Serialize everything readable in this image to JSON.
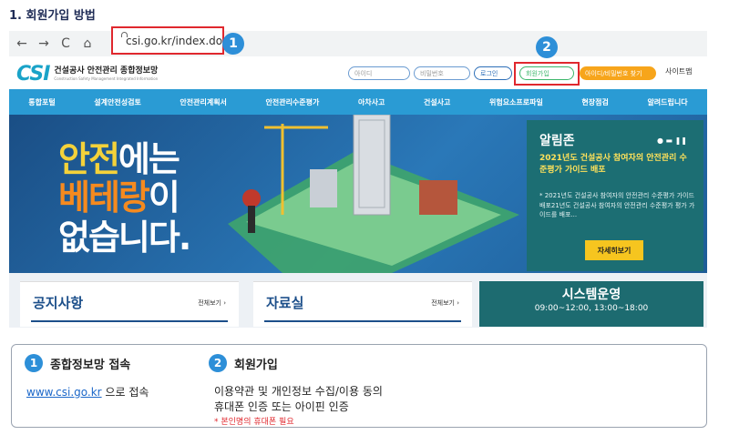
{
  "doc_title": "1. 회원가입 방법",
  "browser": {
    "back_glyph": "←",
    "forward_glyph": "→",
    "reload_glyph": "C",
    "home_glyph": "⌂",
    "url": "csi.go.kr/index.do",
    "badge1": "1",
    "badge2": "2"
  },
  "header": {
    "logo_mark_a": "CS",
    "logo_mark_b": "I",
    "logo_kr": "건설공사 안전관리 종합정보망",
    "logo_en": "Construction Safety Management Integrated Information",
    "id_placeholder": "아이디",
    "pw_placeholder": "비밀번호",
    "login_label": "로그인",
    "signup_label": "회원가입",
    "find_label": "아이디/비밀번호 찾기",
    "sitemap_label": "사이트맵"
  },
  "nav": {
    "items": [
      "통합포털",
      "설계안전성검토",
      "안전관리계획서",
      "안전관리수준평가",
      "아차사고",
      "건설사고",
      "위험요소프로파일",
      "현장점검",
      "알려드립니다"
    ]
  },
  "hero": {
    "line1_a": "안전",
    "line1_b": "에는",
    "line2_a": "베테랑",
    "line2_b": "이",
    "line3": "없습니다."
  },
  "alarm": {
    "title": "알림존",
    "controls": "● ▬ ❚❚",
    "headline": "2021년도 건설공사 참여자의 안전관리 수준평가 가이드 배포",
    "body": "* 2021년도 건설공사 참여자의 안전관리 수준평가 가이드 배포21년도 건설공사 참여자의 안전관리 수준평가 평가 가이드를 배포...",
    "button": "자세히보기"
  },
  "panels": {
    "notice_title": "공지사항",
    "notice_more": "전체보기 ›",
    "data_title": "자료실",
    "data_more": "전체보기 ›",
    "sys_title": "시스템운영",
    "sys_time": "09:00~12:00, 13:00~18:00"
  },
  "instructions": {
    "step1_num": "1",
    "step1_title": "종합정보망 접속",
    "step1_link": "www.csi.go.kr",
    "step1_suffix": " 으로 접속",
    "step2_num": "2",
    "step2_title": "회원가입",
    "step2_line1": "이용약관 및 개인정보 수집/이용 동의",
    "step2_line2": "휴대폰 인증  또는 아이핀 인증",
    "step2_note": "* 본인명의 휴대폰 필요"
  },
  "colors": {
    "nav_blue": "#2a9bd4",
    "alarm_teal": "#1c6e73",
    "highlight_red": "#e0282e",
    "badge_blue": "#2d8fd8"
  }
}
